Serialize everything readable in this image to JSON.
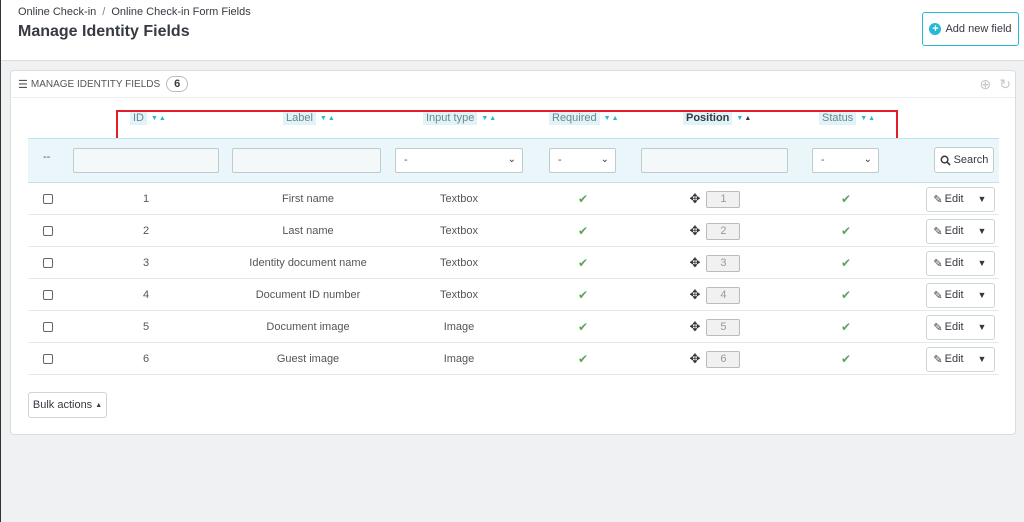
{
  "breadcrumb": {
    "item1": "Online Check-in",
    "sep": "/",
    "item2": "Online Check-in Form Fields"
  },
  "page": {
    "title": "Manage Identity Fields"
  },
  "toolbar": {
    "add_label": "Add new field",
    "add_icon": "plus-circle-icon"
  },
  "panel": {
    "title": "MANAGE IDENTITY FIELDS",
    "count": "6"
  },
  "columns": {
    "id": "ID",
    "label": "Label",
    "input_type": "Input type",
    "required": "Required",
    "position": "Position",
    "status": "Status"
  },
  "filters": {
    "dash": "--",
    "input_type_value": "-",
    "required_value": "-",
    "status_value": "-",
    "search_label": "Search"
  },
  "rows": [
    {
      "id": "1",
      "label": "First name",
      "input_type": "Textbox",
      "position": "1",
      "edit": "Edit"
    },
    {
      "id": "2",
      "label": "Last name",
      "input_type": "Textbox",
      "position": "2",
      "edit": "Edit"
    },
    {
      "id": "3",
      "label": "Identity document name",
      "input_type": "Textbox",
      "position": "3",
      "edit": "Edit"
    },
    {
      "id": "4",
      "label": "Document ID number",
      "input_type": "Textbox",
      "position": "4",
      "edit": "Edit"
    },
    {
      "id": "5",
      "label": "Document image",
      "input_type": "Image",
      "position": "5",
      "edit": "Edit"
    },
    {
      "id": "6",
      "label": "Guest image",
      "input_type": "Image",
      "position": "6",
      "edit": "Edit"
    }
  ],
  "bulk": {
    "label": "Bulk actions"
  },
  "colors": {
    "accent": "#25b9d7",
    "highlight": "#e41e26",
    "check": "#5aa65a"
  }
}
